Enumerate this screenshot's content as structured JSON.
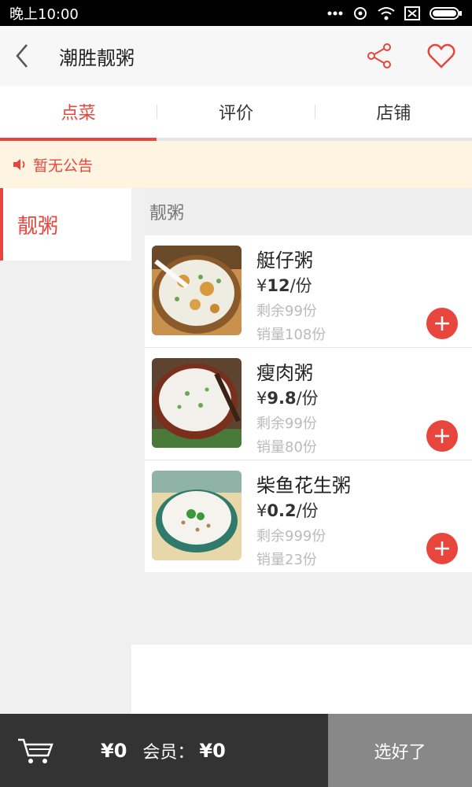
{
  "status_bar": {
    "time": "晚上10:00"
  },
  "header": {
    "title": "潮胜靓粥"
  },
  "tabs": [
    {
      "label": "点菜",
      "active": true
    },
    {
      "label": "评价",
      "active": false
    },
    {
      "label": "店铺",
      "active": false
    }
  ],
  "notice": {
    "text": "暂无公告"
  },
  "categories": [
    {
      "label": "靓粥",
      "active": true
    }
  ],
  "menu": {
    "section_title": "靓粥",
    "dishes": [
      {
        "name": "艇仔粥",
        "currency": "¥",
        "price": "12",
        "unit": "/份",
        "stock": "剩余99份",
        "sales": "销量108份"
      },
      {
        "name": "瘦肉粥",
        "currency": "¥",
        "price": "9.8",
        "unit": "/份",
        "stock": "剩余99份",
        "sales": "销量80份"
      },
      {
        "name": "柴鱼花生粥",
        "currency": "¥",
        "price": "0.2",
        "unit": "/份",
        "stock": "剩余999份",
        "sales": "销量23份"
      }
    ]
  },
  "cart": {
    "total": "¥0",
    "member_label": "会员：",
    "member_price": "¥0",
    "confirm_label": "选好了"
  },
  "colors": {
    "accent": "#e8453c",
    "cart_bg": "#333333",
    "confirm_bg": "#888888",
    "notice_bg": "#fdf5e2"
  }
}
